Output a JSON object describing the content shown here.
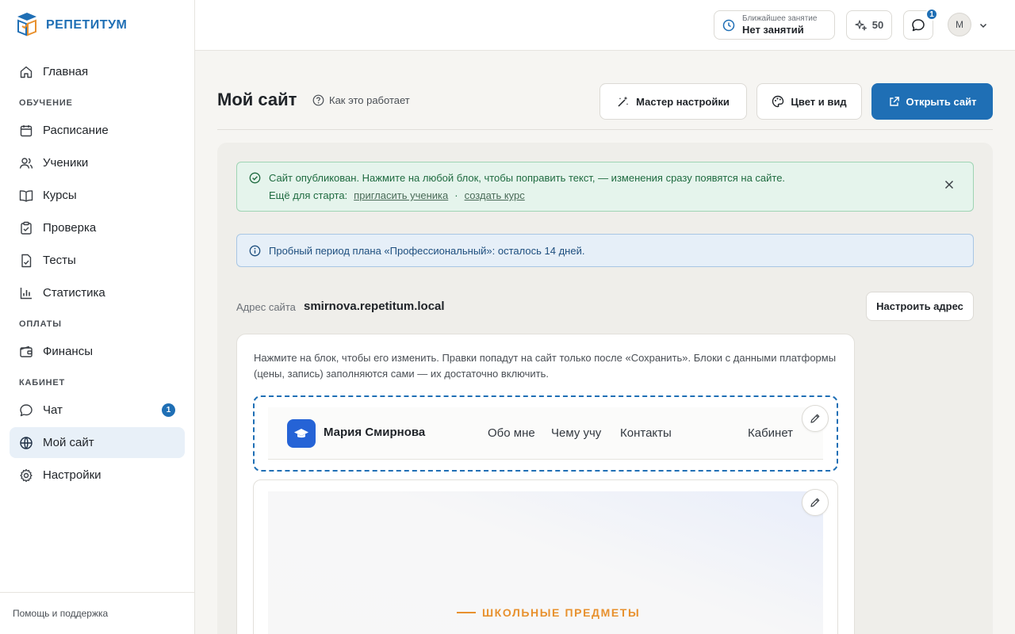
{
  "brand": {
    "name": "РЕПЕТИТУМ"
  },
  "sidebar": {
    "home": "Главная",
    "sections": [
      {
        "title": "ОБУЧЕНИЕ"
      },
      {
        "title": "ОПЛАТЫ"
      },
      {
        "title": "КАБИНЕТ"
      }
    ],
    "items": {
      "schedule": "Расписание",
      "students": "Ученики",
      "courses": "Курсы",
      "review": "Проверка",
      "tests": "Тесты",
      "stats": "Статистика",
      "finance": "Финансы",
      "chat": "Чат",
      "chat_badge": "1",
      "my_site": "Мой сайт",
      "settings": "Настройки"
    },
    "footer": "Помощь и поддержка"
  },
  "topbar": {
    "next_lesson_label": "Ближайшее занятие",
    "next_lesson_value": "Нет занятий",
    "points": "50",
    "chat_badge": "1",
    "avatar_initial": "М"
  },
  "page": {
    "title": "Мой сайт",
    "how_it_works": "Как это работает",
    "wizard_button": "Мастер настройки",
    "theme_button": "Цвет и вид",
    "open_button": "Открыть сайт"
  },
  "alerts": {
    "published": "Сайт опубликован. Нажмите на любой блок, чтобы поправить текст, — изменения сразу появятся на сайте.",
    "start_label": "Ещё для старта:",
    "invite_link": "пригласить ученика",
    "separator": "·",
    "create_course_link": "создать курс",
    "trial": "Пробный период плана «Профессиональный»: осталось 14 дней."
  },
  "address": {
    "label": "Адрес сайта",
    "value": "smirnova.repetitum.local",
    "button": "Настроить адрес"
  },
  "editor": {
    "hint": "Нажмите на блок, чтобы его изменить. Правки попадут на сайт только после «Сохранить». Блоки с данными платформы (цены, запись) заполняются сами — их достаточно включить.",
    "site_name": "Мария Смирнова",
    "menu": [
      "Обо мне",
      "Чему учу",
      "Контакты",
      "Кабинет"
    ],
    "hero_eyebrow": "ШКОЛЬНЫЕ ПРЕДМЕТЫ"
  },
  "colors": {
    "accent": "#1f6fb5",
    "success_bg": "#e5f4ec",
    "info_bg": "#e6eff8",
    "hero_accent": "#e8912e"
  }
}
